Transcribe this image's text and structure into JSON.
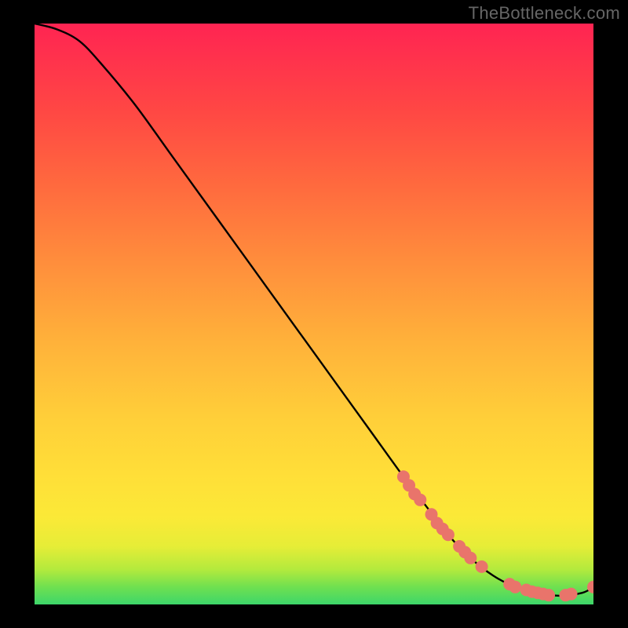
{
  "watermark": "TheBottleneck.com",
  "chart_data": {
    "type": "line",
    "title": "",
    "xlabel": "",
    "ylabel": "",
    "xlim": [
      0,
      100
    ],
    "ylim": [
      0,
      100
    ],
    "curve": {
      "name": "bottleneck-curve",
      "x": [
        0,
        4,
        8,
        12,
        18,
        24,
        30,
        36,
        42,
        48,
        54,
        60,
        66,
        70,
        74,
        78,
        82,
        86,
        90,
        94,
        98,
        100
      ],
      "y": [
        100,
        99,
        97,
        93,
        86,
        78,
        70,
        62,
        54,
        46,
        38,
        30,
        22,
        17,
        12,
        8,
        5,
        3,
        2,
        1.5,
        2,
        3
      ]
    },
    "markers": {
      "name": "data-points",
      "color": "#e9746b",
      "radius_px": 8,
      "points": [
        {
          "x": 66,
          "y": 22
        },
        {
          "x": 67,
          "y": 20.5
        },
        {
          "x": 68,
          "y": 19
        },
        {
          "x": 69,
          "y": 18
        },
        {
          "x": 71,
          "y": 15.5
        },
        {
          "x": 72,
          "y": 14
        },
        {
          "x": 73,
          "y": 13
        },
        {
          "x": 74,
          "y": 12
        },
        {
          "x": 76,
          "y": 10
        },
        {
          "x": 77,
          "y": 9
        },
        {
          "x": 78,
          "y": 8
        },
        {
          "x": 80,
          "y": 6.5
        },
        {
          "x": 85,
          "y": 3.5
        },
        {
          "x": 86,
          "y": 3
        },
        {
          "x": 88,
          "y": 2.5
        },
        {
          "x": 89,
          "y": 2.2
        },
        {
          "x": 90,
          "y": 2
        },
        {
          "x": 91,
          "y": 1.8
        },
        {
          "x": 92,
          "y": 1.6
        },
        {
          "x": 95,
          "y": 1.6
        },
        {
          "x": 96,
          "y": 1.8
        },
        {
          "x": 100,
          "y": 3
        }
      ]
    },
    "gradient_stops": [
      {
        "y": 0,
        "color": "#3dd66a"
      },
      {
        "y": 3,
        "color": "#6fe050"
      },
      {
        "y": 6,
        "color": "#b3ea3d"
      },
      {
        "y": 10,
        "color": "#e6ed37"
      },
      {
        "y": 15,
        "color": "#fbe937"
      },
      {
        "y": 22,
        "color": "#ffdf38"
      },
      {
        "y": 32,
        "color": "#ffcf39"
      },
      {
        "y": 45,
        "color": "#ffb23a"
      },
      {
        "y": 58,
        "color": "#ff903c"
      },
      {
        "y": 72,
        "color": "#ff6a3e"
      },
      {
        "y": 85,
        "color": "#ff4744"
      },
      {
        "y": 100,
        "color": "#ff2452"
      }
    ]
  }
}
